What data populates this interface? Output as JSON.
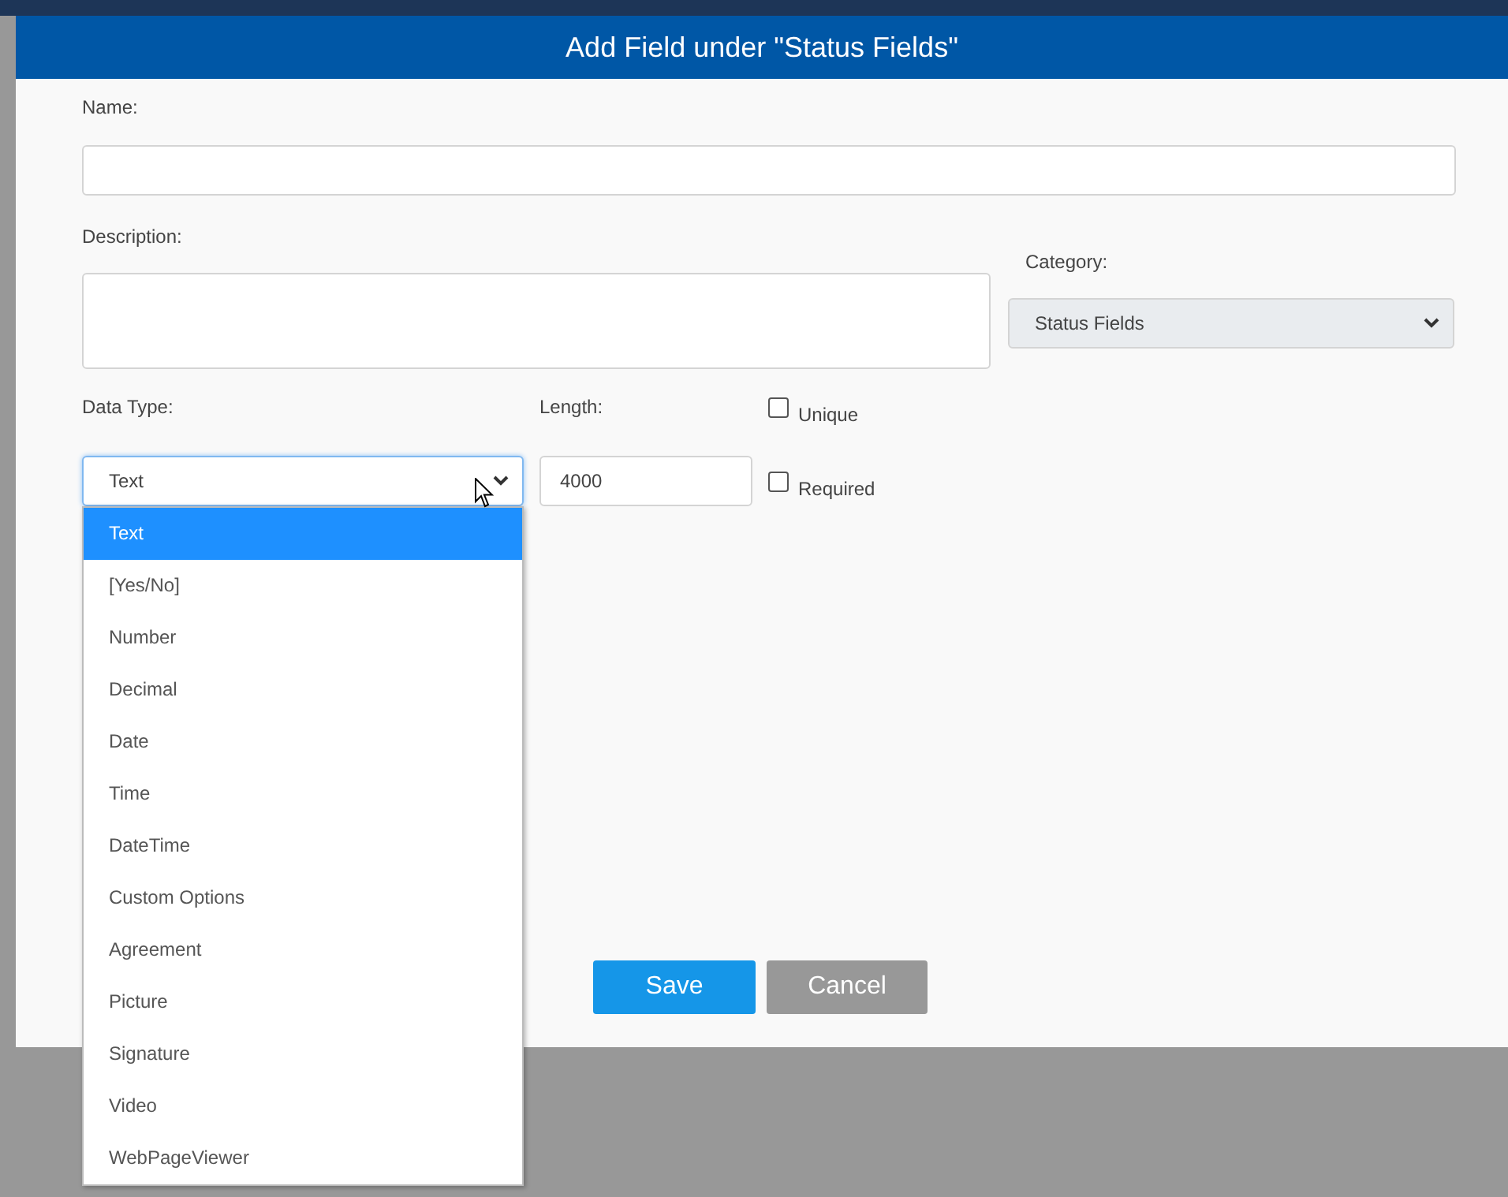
{
  "dialog": {
    "title": "Add Field under \"Status Fields\""
  },
  "name": {
    "label": "Name:"
  },
  "description": {
    "label": "Description:"
  },
  "category": {
    "label": "Category:",
    "value": "Status Fields",
    "disabled": true
  },
  "data_type": {
    "label": "Data Type:",
    "value": "Text",
    "expanded": true,
    "options": [
      {
        "label": "Text",
        "selected": true
      },
      {
        "label": "[Yes/No]",
        "selected": false
      },
      {
        "label": "Number",
        "selected": false
      },
      {
        "label": "Decimal",
        "selected": false
      },
      {
        "label": "Date",
        "selected": false
      },
      {
        "label": "Time",
        "selected": false
      },
      {
        "label": "DateTime",
        "selected": false
      },
      {
        "label": "Custom Options",
        "selected": false
      },
      {
        "label": "Agreement",
        "selected": false
      },
      {
        "label": "Picture",
        "selected": false
      },
      {
        "label": "Signature",
        "selected": false
      },
      {
        "label": "Video",
        "selected": false
      },
      {
        "label": "WebPageViewer",
        "selected": false
      }
    ]
  },
  "length": {
    "label": "Length:",
    "value": "4000"
  },
  "checkboxes": [
    {
      "label": "Unique",
      "checked": false
    },
    {
      "label": "Required",
      "checked": false
    }
  ],
  "buttons": [
    {
      "label": "Save",
      "kind": "primary"
    },
    {
      "label": "Cancel",
      "kind": "secondary"
    }
  ]
}
